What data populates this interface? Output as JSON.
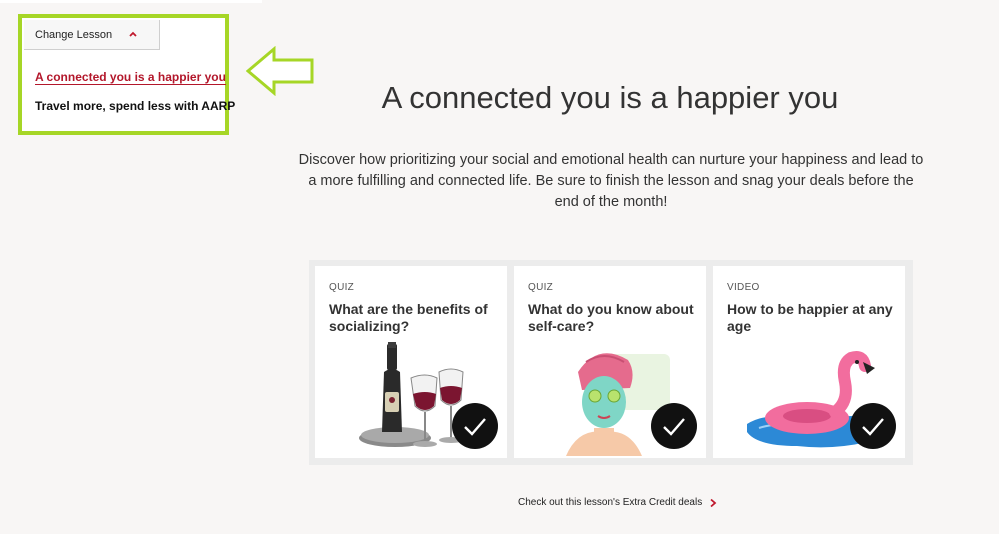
{
  "lesson_menu": {
    "toggle_label": "Change Lesson",
    "items": [
      {
        "label": "A connected you is a happier you",
        "active": true
      },
      {
        "label": "Travel more, spend less with AARP",
        "active": false
      }
    ]
  },
  "hero": {
    "title": "A connected you is a happier you",
    "description": "Discover how prioritizing your social and emotional health can nurture your happiness and lead to a more fulfilling and connected life. Be sure to finish the lesson and snag your deals before the end of the month!"
  },
  "cards": [
    {
      "type": "QUIZ",
      "title": "What are the benefits of socializing?",
      "icon": "wine-bottle-glasses-icon",
      "completed": true
    },
    {
      "type": "QUIZ",
      "title": "What do you know about self-care?",
      "icon": "face-mask-icon",
      "completed": true
    },
    {
      "type": "VIDEO",
      "title": "How to be happier at any age",
      "icon": "flamingo-float-icon",
      "completed": true
    }
  ],
  "extra_credit": {
    "label": "Check out this lesson's Extra Credit deals"
  },
  "colors": {
    "highlight": "#a6d626",
    "accent": "#b3172b",
    "panel": "#ececec"
  }
}
